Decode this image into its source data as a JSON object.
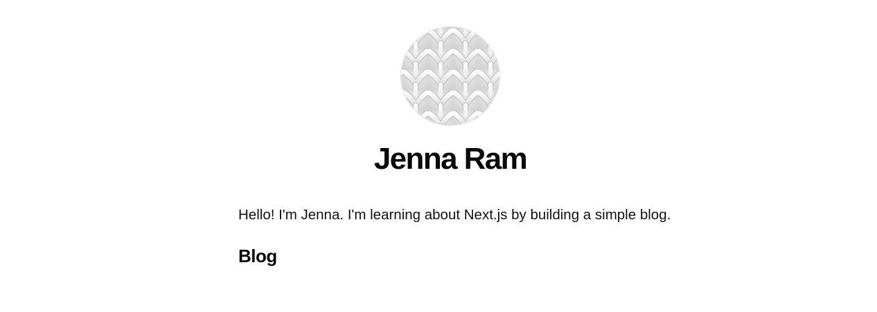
{
  "header": {
    "avatar_icon": "woven-knit-pattern-avatar",
    "name": "Jenna Ram"
  },
  "main": {
    "intro_text": "Hello! I'm Jenna. I'm learning about Next.js by building a simple blog.",
    "blog_heading": "Blog"
  },
  "colors": {
    "background": "#ffffff",
    "text": "#111111",
    "avatar_light": "#f4f4f4",
    "avatar_shadow": "#c9c9c9"
  }
}
